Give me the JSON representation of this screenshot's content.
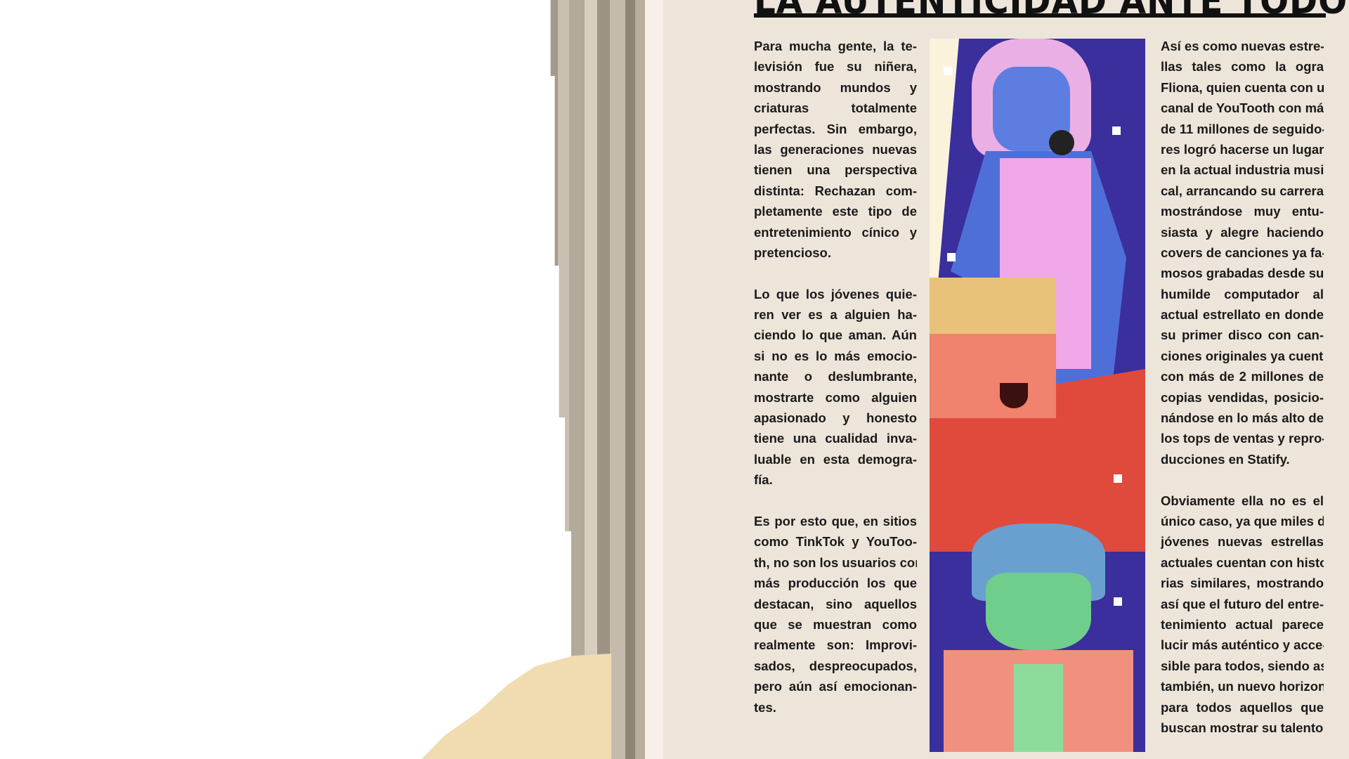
{
  "article": {
    "title": "LA AUTENTICIDAD ANTE TODO",
    "left_column": [
      [
        "Para mucha gente, la te-",
        "levisión fue su niñera,",
        "mostrando mundos y",
        "criaturas totalmente",
        "perfectas. Sin embargo,",
        "las generaciones nuevas",
        "tienen una perspectiva",
        "distinta: Rechazan com-",
        "pletamente este tipo de",
        "entretenimiento cínico y",
        "pretencioso."
      ],
      [
        "Lo que los jóvenes quie-",
        "ren ver es a alguien ha-",
        "ciendo lo que aman. Aún",
        "si no es lo más emocio-",
        "nante o deslumbrante,",
        "mostrarte como alguien",
        "apasionado y honesto",
        "tiene una cualidad inva-",
        "luable en esta demogra-",
        "fía."
      ],
      [
        "Es por esto que, en sitios",
        "como TinkTok y YouToo-",
        "th, no son los usuarios con",
        "más producción los que",
        "destacan, sino aquellos",
        "que se muestran como",
        "realmente son: Improvi-",
        "sados, despreocupados,",
        "pero aún así emocionan-",
        "tes."
      ]
    ],
    "right_column": [
      [
        "Así es como nuevas estre-",
        "llas tales como la ogra",
        "Fliona, quien cuenta con un",
        "canal de YouTooth con más",
        "de 11 millones de seguido-",
        "res logró hacerse un lugar",
        "en la actual industria musi-",
        "cal, arrancando su carrera",
        "mostrándose muy entu-",
        "siasta y alegre haciendo",
        "covers de canciones ya fa-",
        "mosos grabadas desde su",
        "humilde computador al",
        "actual estrellato en donde",
        "su primer disco con can-",
        "ciones originales ya cuentan",
        "con más de 2 millones de",
        "copias vendidas, posicio-",
        "nándose en lo más alto de",
        "los tops de ventas y repro-",
        "ducciones en Statify."
      ],
      [
        "Obviamente ella no es el",
        "único caso, ya que miles de",
        "jóvenes nuevas estrellas",
        "actuales cuentan con histo-",
        "rias similares, mostrando",
        "así que el futuro del entre-",
        "tenimiento actual parece",
        "lucir más auténtico y acce-",
        "sible para todos, siendo así",
        "también, un nuevo horizonte",
        "para todos aquellos que",
        "buscan mostrar su talento."
      ]
    ]
  },
  "colors": {
    "page": "#ede5da",
    "ink": "#111111",
    "illustration_bg": "#3a2f9c"
  }
}
